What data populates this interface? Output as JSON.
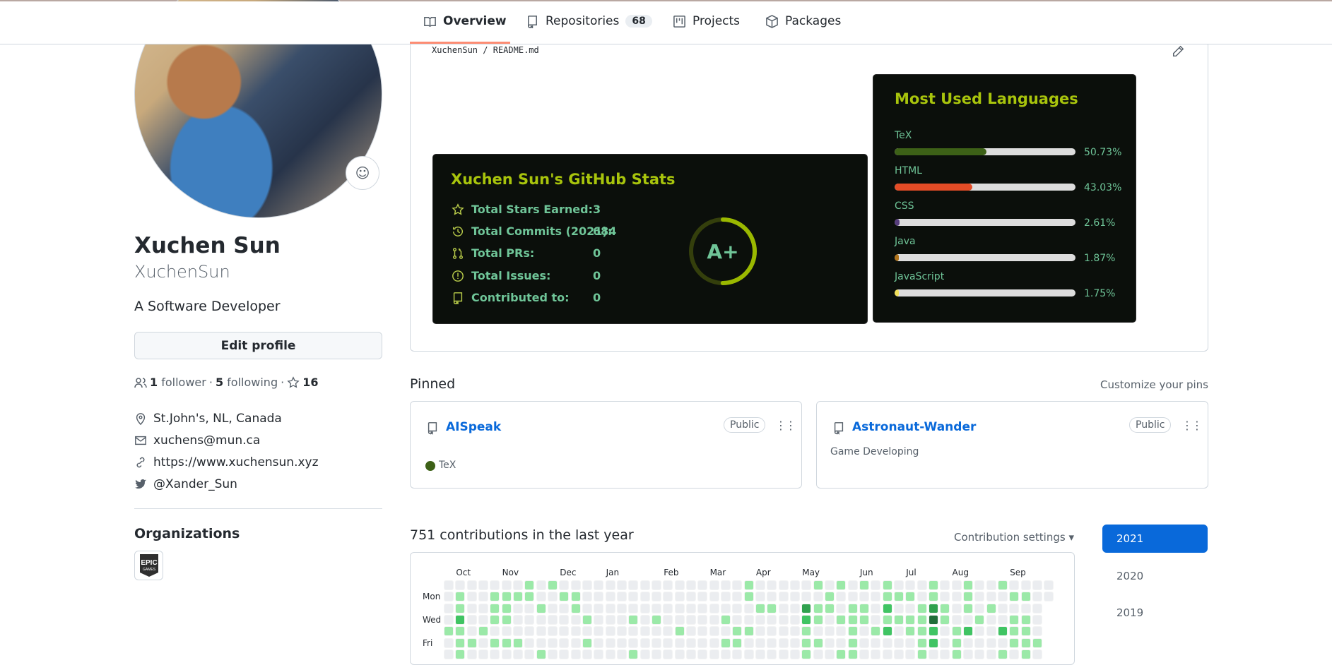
{
  "nav": {
    "tabs": [
      {
        "label": "Overview",
        "icon": "book-icon",
        "active": true
      },
      {
        "label": "Repositories",
        "icon": "repo-icon",
        "count": "68"
      },
      {
        "label": "Projects",
        "icon": "project-icon"
      },
      {
        "label": "Packages",
        "icon": "package-icon"
      }
    ],
    "accent": "#fd8c73"
  },
  "profile": {
    "name": "Xuchen Sun",
    "login": "XuchenSun",
    "bio": "A Software Developer",
    "edit_label": "Edit profile",
    "followers": "1",
    "followers_label": "follower",
    "following": "5",
    "following_label": "following",
    "stars": "16",
    "sep": "·",
    "location": "St.John's, NL, Canada",
    "email": "xuchens@mun.ca",
    "website": "https://www.xuchensun.xyz",
    "twitter": "@Xander_Sun",
    "organizations_heading": "Organizations",
    "org": "EPIC GAMES"
  },
  "readme": {
    "owner": "XuchenSun",
    "sep": "/",
    "file": "README.md"
  },
  "stats": {
    "title": "Xuchen Sun's GitHub Stats",
    "rank": "A+",
    "rank_progress": 0.5,
    "title_color": "#a8c40c",
    "text_color": "#6fc598",
    "rows": [
      {
        "icon": "star-icon",
        "label": "Total Stars Earned:",
        "value": "3"
      },
      {
        "icon": "history-icon",
        "label": "Total Commits (2021):",
        "value": "684"
      },
      {
        "icon": "pull-request-icon",
        "label": "Total PRs:",
        "value": "0"
      },
      {
        "icon": "issue-icon",
        "label": "Total Issues:",
        "value": "0"
      },
      {
        "icon": "repo-icon",
        "label": "Contributed to:",
        "value": "0"
      }
    ]
  },
  "languages": {
    "title": "Most Used Languages",
    "items": [
      {
        "name": "TeX",
        "pct": "50.73%",
        "value": 50.73,
        "color": "#3d6117"
      },
      {
        "name": "HTML",
        "pct": "43.03%",
        "value": 43.03,
        "color": "#e34c26"
      },
      {
        "name": "CSS",
        "pct": "2.61%",
        "value": 2.61,
        "color": "#563d7c"
      },
      {
        "name": "Java",
        "pct": "1.87%",
        "value": 1.87,
        "color": "#b07219"
      },
      {
        "name": "JavaScript",
        "pct": "1.75%",
        "value": 1.75,
        "color": "#f1e05a"
      }
    ]
  },
  "pinned": {
    "heading": "Pinned",
    "customize": "Customize your pins",
    "repos": [
      {
        "name": "AISpeak",
        "visibility": "Public",
        "language": "TeX",
        "lang_color": "#3d6117"
      },
      {
        "name": "Astronaut-Wander",
        "visibility": "Public",
        "description": "Game Developing"
      }
    ]
  },
  "contributions": {
    "heading": "751 contributions in the last year",
    "settings": "Contribution settings ▾",
    "years": [
      "2021",
      "2020",
      "2019"
    ],
    "active_year": "2021",
    "months": [
      {
        "label": "Oct",
        "col": 1
      },
      {
        "label": "Nov",
        "col": 5
      },
      {
        "label": "Dec",
        "col": 10
      },
      {
        "label": "Jan",
        "col": 14
      },
      {
        "label": "Feb",
        "col": 19
      },
      {
        "label": "Mar",
        "col": 23
      },
      {
        "label": "Apr",
        "col": 27
      },
      {
        "label": "May",
        "col": 31
      },
      {
        "label": "Jun",
        "col": 36
      },
      {
        "label": "Jul",
        "col": 40
      },
      {
        "label": "Aug",
        "col": 44
      },
      {
        "label": "Sep",
        "col": 49
      }
    ],
    "days": [
      {
        "label": "Mon",
        "row": 1
      },
      {
        "label": "Wed",
        "row": 3
      },
      {
        "label": "Fri",
        "row": 5
      }
    ],
    "palette": [
      "#ebedf0",
      "#9be9a8",
      "#40c463",
      "#30a14e",
      "#216e39"
    ],
    "levels": [
      "00000001010000000000000000100000101010100010010010000",
      "01001111001100000000000000100000010000111010010001100",
      "0100110010010000000000000001100311011020013101010000",
      "0200110000001000101000001000000210111011114100100110",
      "1101000000000000000010000110000100010120112012002110",
      "0110111000001000000000001100000110010000012010000111",
      "0100000010000000100000000000000100110000010010001010"
    ]
  }
}
